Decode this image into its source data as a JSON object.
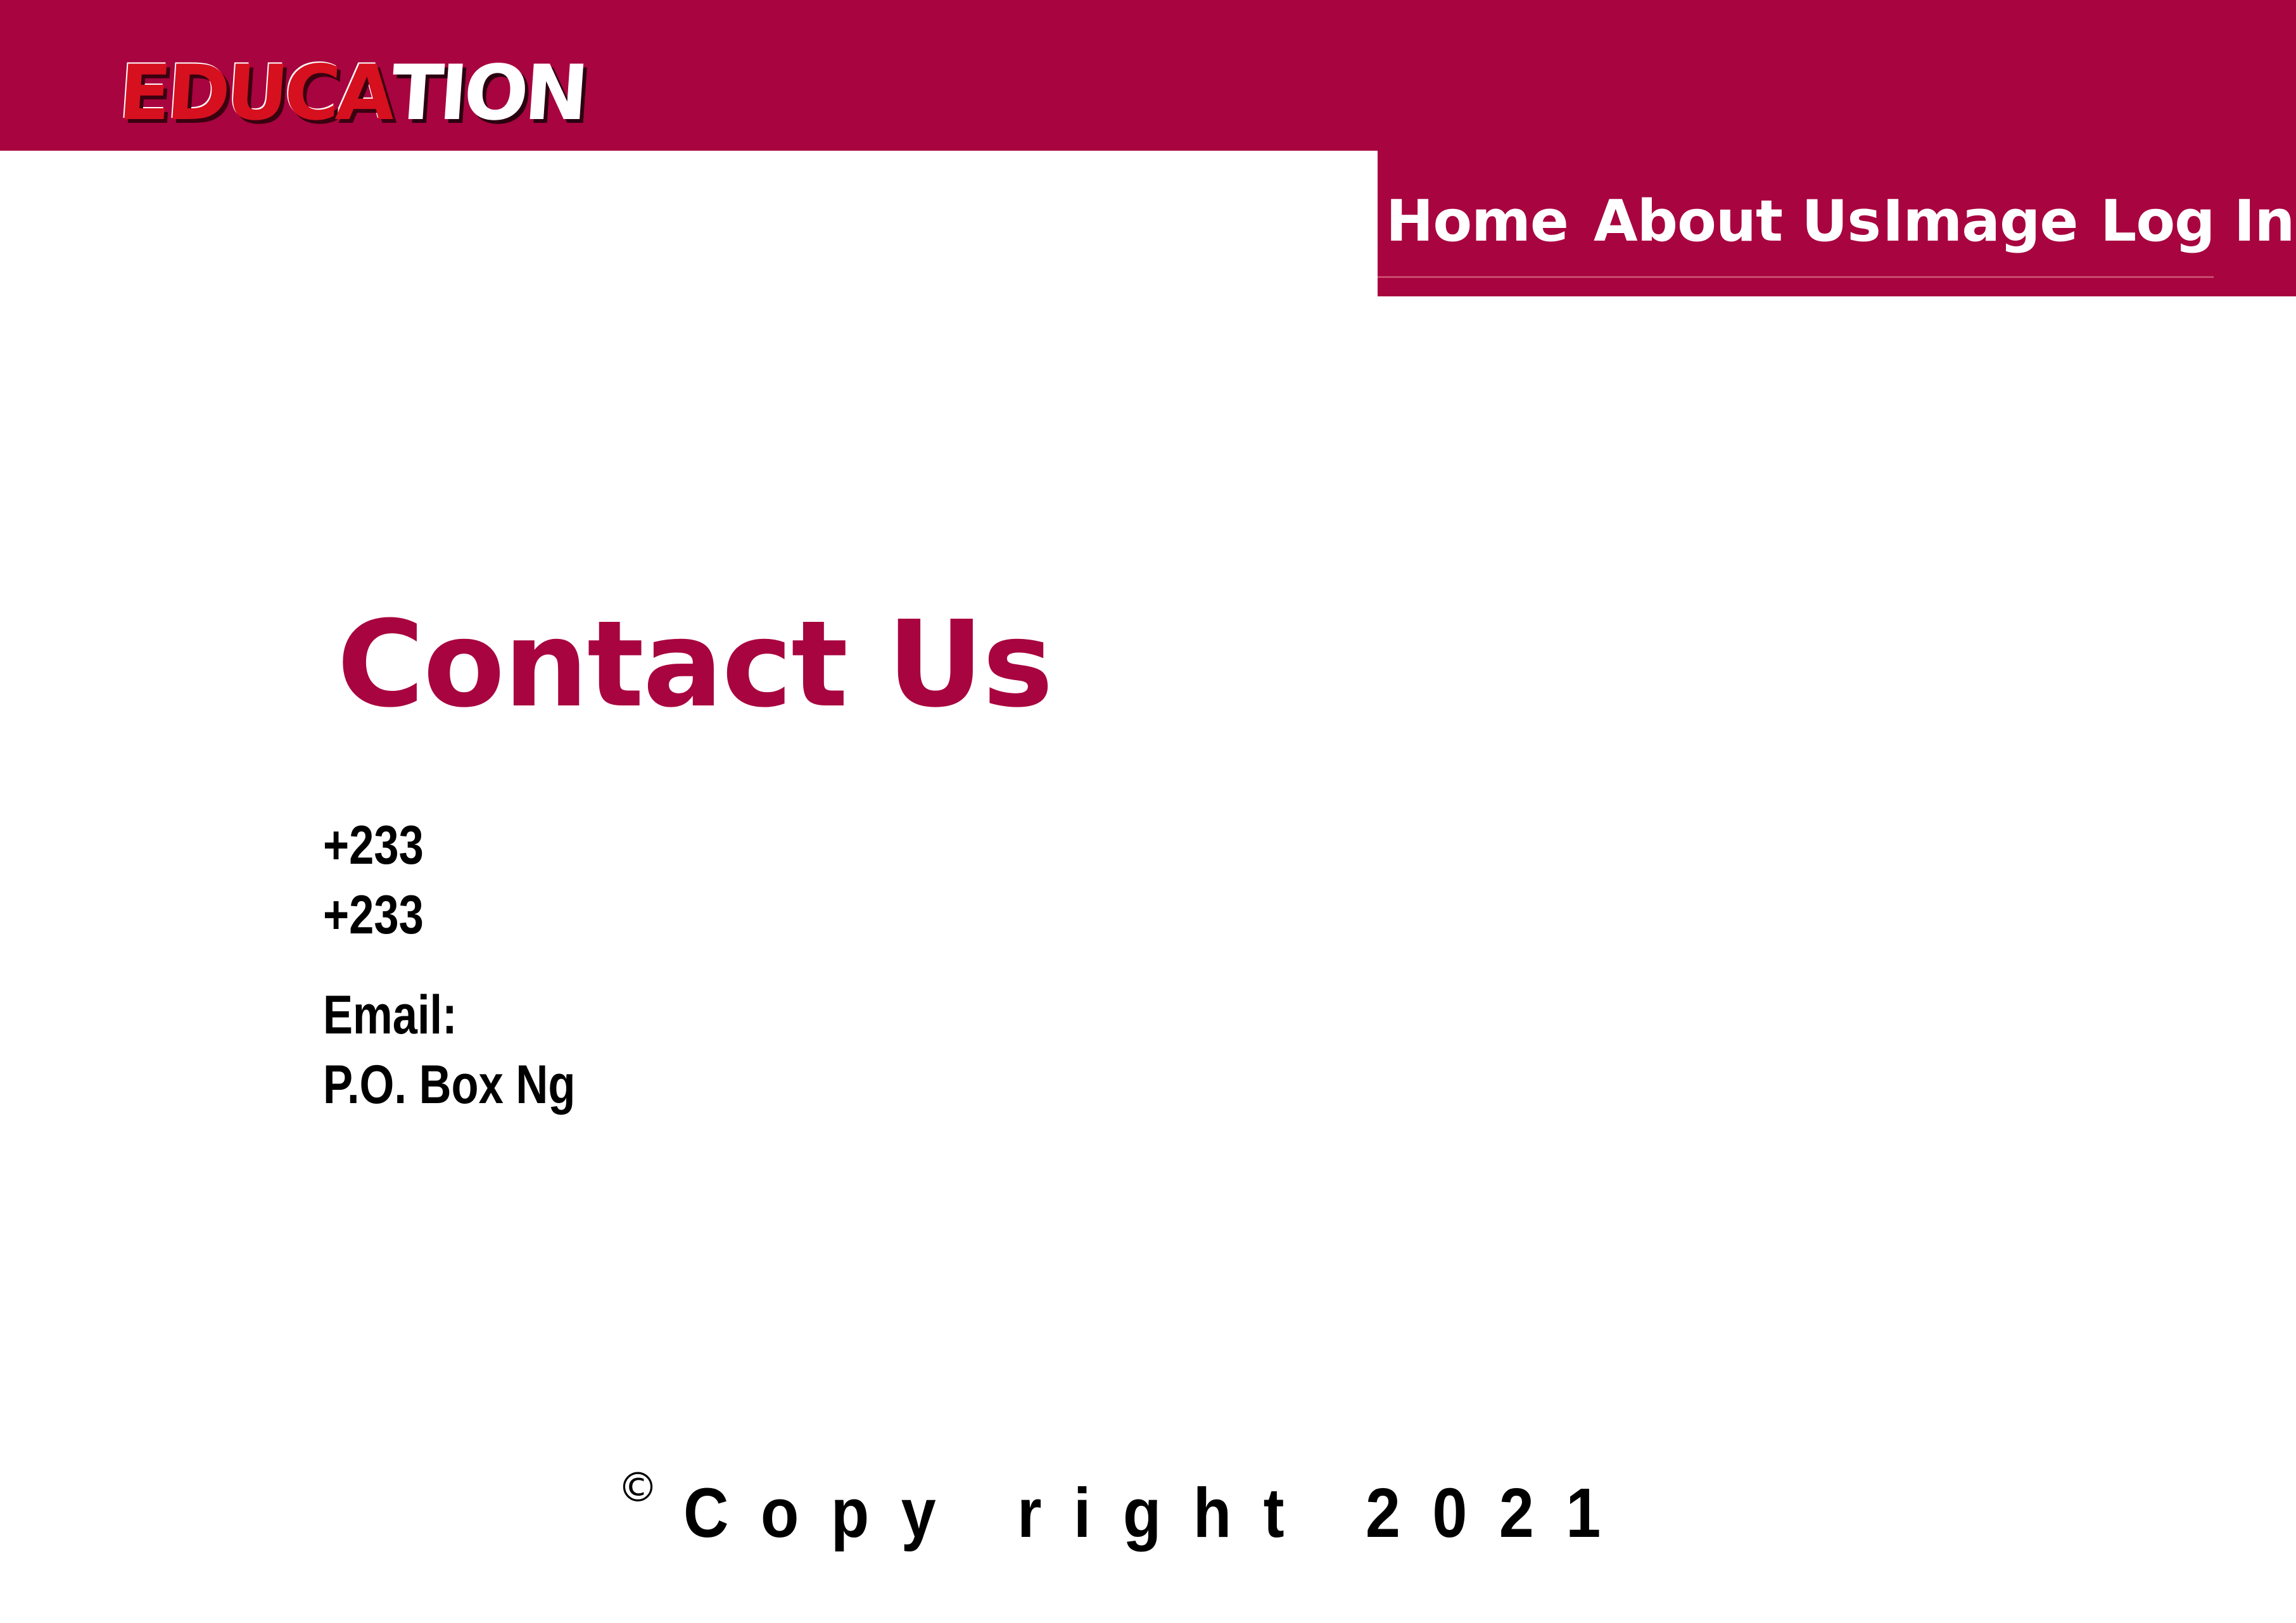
{
  "brand": {
    "logo_part1": "EDUCA",
    "logo_part2": "TION",
    "color_primary": "#a8043f",
    "color_logo_red": "#d6101e"
  },
  "nav": {
    "items": [
      {
        "label": "Home"
      },
      {
        "label": "About Us"
      },
      {
        "label": "Image"
      },
      {
        "label": "Log In"
      }
    ]
  },
  "contact": {
    "title": "Contact Us",
    "phone_1": "+233",
    "phone_2": "+233",
    "email_label": "Email:",
    "address": "P.O. Box Ng"
  },
  "footer": {
    "copyright_symbol": "©",
    "copyright_text": "Copy right 2021"
  }
}
